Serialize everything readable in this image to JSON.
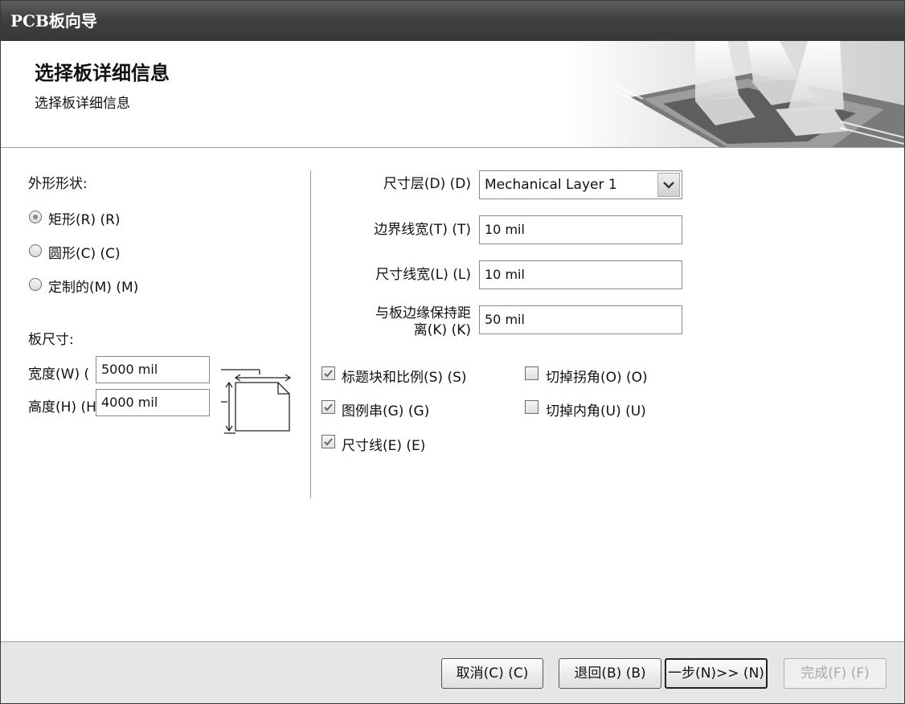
{
  "window": {
    "title": "PCB板向导"
  },
  "header": {
    "title": "选择板详细信息",
    "subtitle": "选择板详细信息"
  },
  "left": {
    "shape_label": "外形形状:",
    "shapes": [
      {
        "label": "矩形(R) (R)",
        "selected": true
      },
      {
        "label": "圆形(C) (C)",
        "selected": false
      },
      {
        "label": "定制的(M) (M)",
        "selected": false
      }
    ],
    "size_label": "板尺寸:",
    "width_label": "宽度(W) (",
    "width_value": "5000 mil",
    "height_label": "高度(H) (H",
    "height_value": "4000 mil"
  },
  "right": {
    "dim_layer_label": "尺寸层(D) (D)",
    "dim_layer_value": "Mechanical Layer 1",
    "border_width_label": "边界线宽(T) (T)",
    "border_width_value": "10 mil",
    "dim_line_width_label": "尺寸线宽(L) (L)",
    "dim_line_width_value": "10 mil",
    "keep_out_label_line1": "与板边缘保持距",
    "keep_out_label_line2": "离(K) (K)",
    "keep_out_value": "50 mil",
    "checks": {
      "title_block": {
        "label": "标题块和比例(S) (S)",
        "checked": true
      },
      "legend_string": {
        "label": "图例串(G) (G)",
        "checked": true
      },
      "dimension_lines": {
        "label": "尺寸线(E) (E)",
        "checked": true
      },
      "corner_cutoff": {
        "label": "切掉拐角(O) (O)",
        "checked": false
      },
      "inner_cutoff": {
        "label": "切掉内角(U) (U)",
        "checked": false
      }
    }
  },
  "footer": {
    "cancel": "取消(C) (C)",
    "back": "退回(B) (B)",
    "next": "一步(N)>> (N)",
    "finish": "完成(F) (F)"
  }
}
